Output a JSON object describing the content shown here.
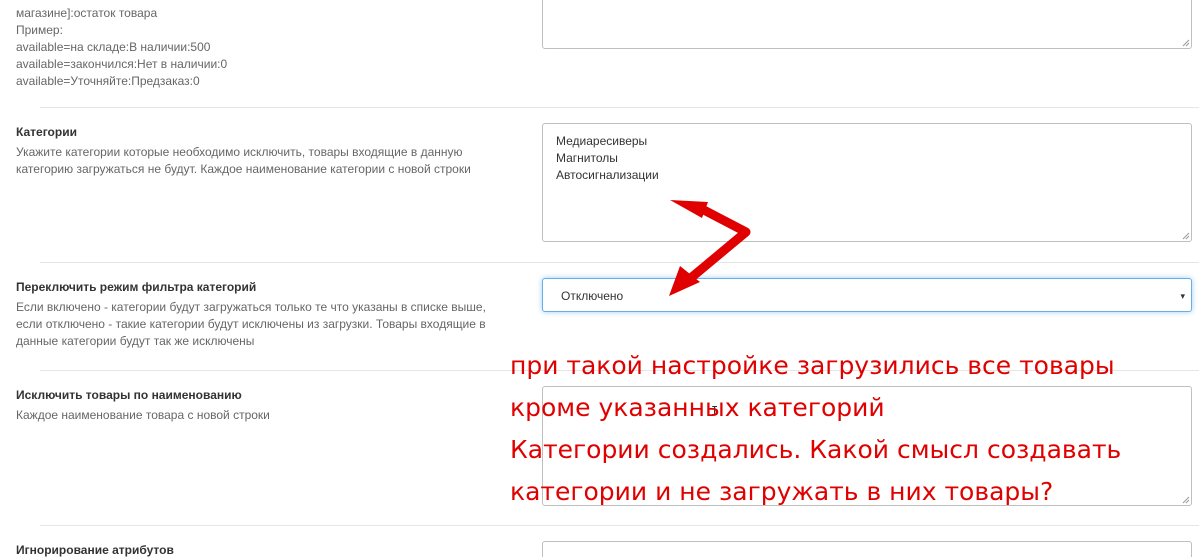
{
  "top_field": {
    "desc_lines": [
      "магазине]:остаток товара",
      "Пример:",
      "available=на складе:В наличии:500",
      "available=закончился:Нет в наличии:0",
      "available=Уточняйте:Предзаказ:0"
    ]
  },
  "categories_field": {
    "title": "Категории",
    "description": "Укажите категории которые необходимо исключить, товары входящие в данную категорию загружаться не будут. Каждое наименование категории с новой строки",
    "values": [
      "Медиаресиверы",
      "Магнитолы",
      "Автосигнализации"
    ]
  },
  "filter_mode_field": {
    "title": "Переключить режим фильтра категорий",
    "description": "Если включено - категории будут загружаться только те что указаны в списке выше, если отключено - такие категории будут исключены из загрузки. Товары входящие в данные категории будут так же исключены",
    "selected": "Отключено"
  },
  "exclude_products_field": {
    "title": "Исключить товары по наименованию",
    "description": "Каждое наименование товара с новой строки",
    "value": ""
  },
  "ignore_attributes_field": {
    "title": "Игнорирование атрибутов"
  },
  "annotation": {
    "lines": [
      "при такой настройке загрузились все товары",
      "кроме указанных категорий",
      "Категории создались. Какой смысл создавать",
      "категории и не загружать в них товары?"
    ],
    "color": "#e00000"
  },
  "icons": {
    "select_caret": "▾",
    "arrow_shape": "double-headed-zigzag-arrow"
  }
}
